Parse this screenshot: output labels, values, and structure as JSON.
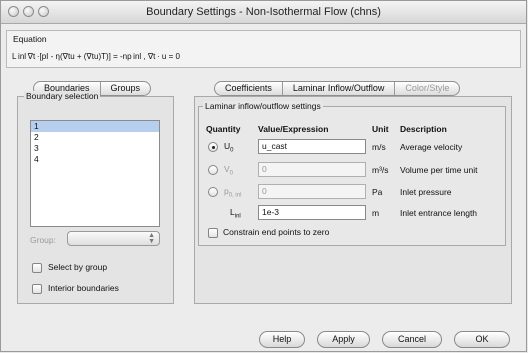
{
  "window": {
    "title": "Boundary Settings - Non-Isothermal Flow (chns)"
  },
  "equation": {
    "label": "Equation",
    "text": "L inl ∇t ·[pI - η(∇tu + (∇tu)T)] = -np inl , ∇t · u = 0"
  },
  "left_tabs": [
    "Boundaries",
    "Groups"
  ],
  "boundary_selection": {
    "legend": "Boundary selection",
    "items": [
      "1",
      "2",
      "3",
      "4"
    ],
    "selected_index": 0,
    "group_label": "Group:",
    "group_value": "",
    "select_by_group": "Select by group",
    "interior_boundaries": "Interior boundaries"
  },
  "right_tabs": [
    {
      "label": "Coefficients",
      "enabled": true
    },
    {
      "label": "Laminar Inflow/Outflow",
      "enabled": true
    },
    {
      "label": "Color/Style",
      "enabled": false
    }
  ],
  "settings": {
    "legend": "Laminar inflow/outflow settings",
    "headers": {
      "quantity": "Quantity",
      "value": "Value/Expression",
      "unit": "Unit",
      "description": "Description"
    },
    "rows": [
      {
        "quantity": "U",
        "sub": "0",
        "value": "u_cast",
        "unit": "m/s",
        "description": "Average velocity",
        "selected": true,
        "enabled": true
      },
      {
        "quantity": "V",
        "sub": "0",
        "value": "0",
        "unit": "m³/s",
        "description": "Volume per time unit",
        "selected": false,
        "enabled": false
      },
      {
        "quantity": "p",
        "sub": "0, inl",
        "value": "0",
        "unit": "Pa",
        "description": "Inlet pressure",
        "selected": false,
        "enabled": false
      },
      {
        "quantity": "L",
        "sub": "inl",
        "value": "1e-3",
        "unit": "m",
        "description": "Inlet entrance length",
        "enabled": true
      }
    ],
    "constrain_label": "Constrain end points to zero"
  },
  "buttons": {
    "help": "Help",
    "apply": "Apply",
    "cancel": "Cancel",
    "ok": "OK"
  }
}
